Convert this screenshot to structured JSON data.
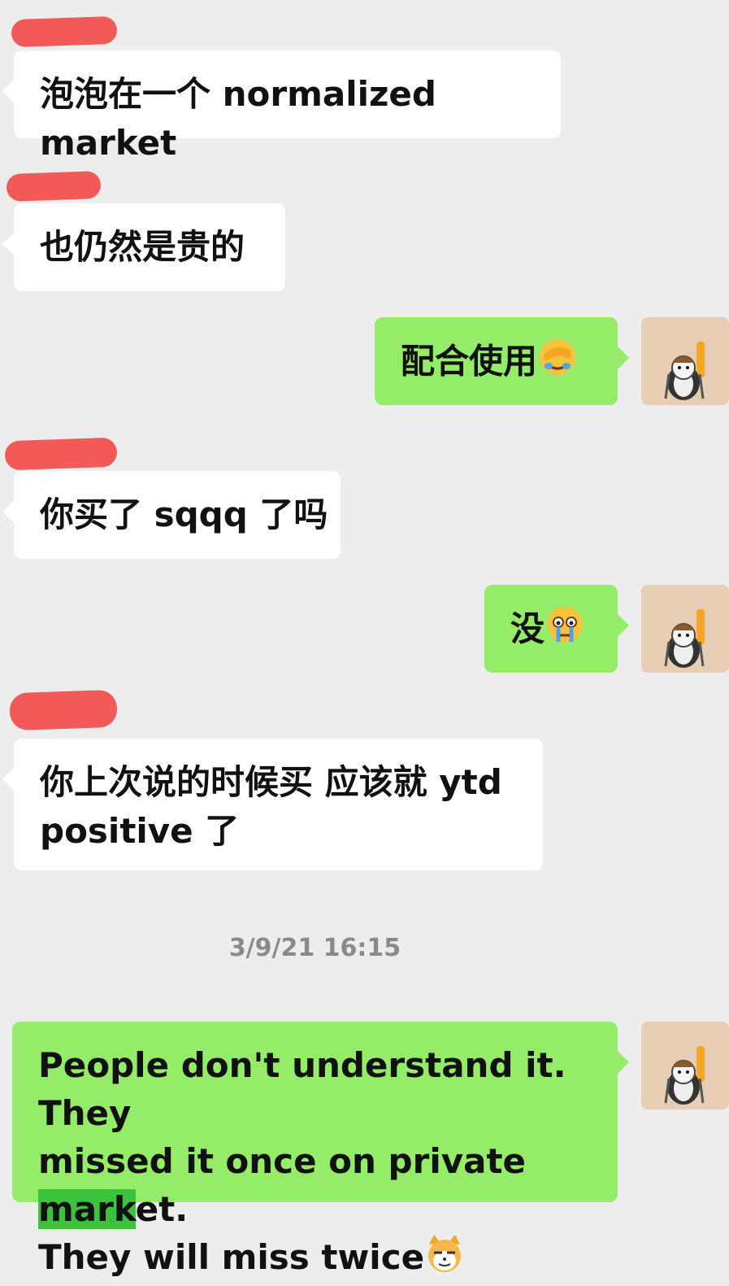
{
  "messages": [
    {
      "side": "in",
      "text": "泡泡在一个 normalized market"
    },
    {
      "side": "in",
      "text": "也仍然是贵的"
    },
    {
      "side": "out",
      "text": "配合使用",
      "emoji": "facepalm-emoji"
    },
    {
      "side": "in",
      "text": "你买了 sqqq 了吗"
    },
    {
      "side": "out",
      "text": "没",
      "emoji": "crying-emoji"
    },
    {
      "side": "in",
      "line1": "你上次说的时候买 应该就 ytd",
      "line2": "positive 了"
    },
    {
      "side": "out",
      "line1": "People don't understand it. They",
      "line2a": "missed it once on private ",
      "line2hl": "mark",
      "line2b": "et.",
      "line3": "They will miss twice",
      "emoji": "cat-emoji"
    }
  ],
  "timestamp": "3/9/21 16:15",
  "colors": {
    "incoming": "#ffffff",
    "outgoing": "#95ec69",
    "background": "#ededed",
    "redaction": "#f25a5a"
  }
}
